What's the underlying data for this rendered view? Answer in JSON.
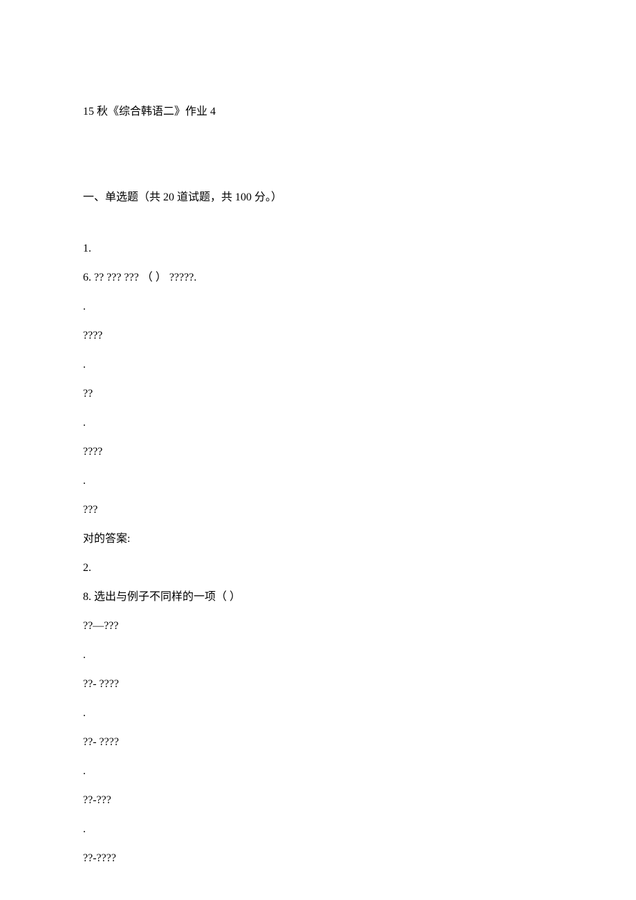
{
  "title": "15 秋《综合韩语二》作业 4",
  "section_header": "一、单选题（共 20 道试题，共 100 分。）",
  "q1": {
    "num": "1.",
    "stem": "6. ?? ??? ??? （   ） ?????.",
    "dot1": ".",
    "opt1": "????",
    "dot2": ".",
    "opt2": "??",
    "dot3": ".",
    "opt3": "????",
    "dot4": ".",
    "opt4": "???",
    "answer_label": "对的答案:"
  },
  "q2": {
    "num": "2.",
    "stem": "8. 选出与例子不同样的一项（     ）",
    "example": "??—???",
    "dot1": ".",
    "opt1": "??- ????",
    "dot2": ".",
    "opt2": "??- ????",
    "dot3": ".",
    "opt3": "??-???",
    "dot4": ".",
    "opt4": "??-????"
  }
}
